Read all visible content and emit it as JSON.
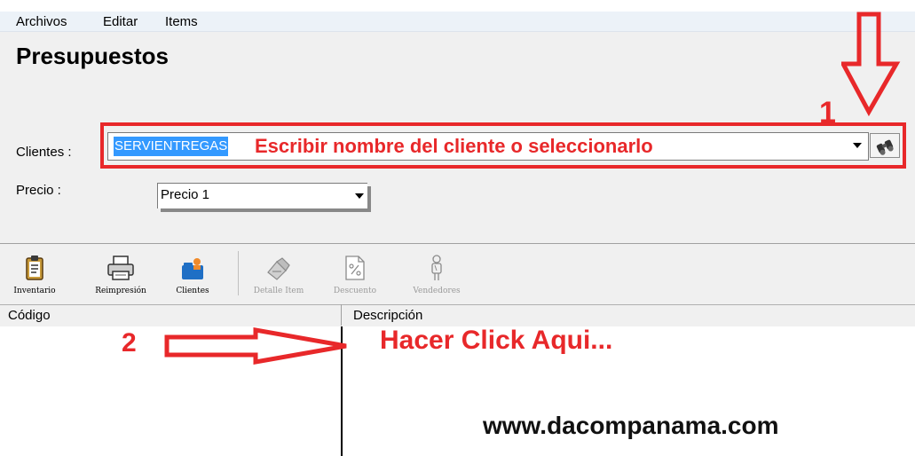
{
  "menu": {
    "items": [
      "Archivos",
      "Editar",
      "Items"
    ]
  },
  "page": {
    "title": "Presupuestos"
  },
  "form": {
    "clients_label": "Clientes :",
    "client_value": "SERVIENTREGAS",
    "price_label": "Precio :",
    "price_value": "Precio 1"
  },
  "toolbar": {
    "items": [
      {
        "label": "Inventario",
        "icon": "clipboard-icon",
        "enabled": true
      },
      {
        "label": "Reimpresión",
        "icon": "printer-icon",
        "enabled": true
      },
      {
        "label": "Clientes",
        "icon": "clients-icon",
        "enabled": true
      },
      {
        "label": "Detalle Item",
        "icon": "edit-item-icon",
        "enabled": false
      },
      {
        "label": "Descuento",
        "icon": "discount-icon",
        "enabled": false
      },
      {
        "label": "Vendedores",
        "icon": "sellers-icon",
        "enabled": false
      }
    ]
  },
  "grid": {
    "columns": [
      "Código",
      "Descripción"
    ]
  },
  "annotations": {
    "step1_number": "1",
    "step1_text": "Escribir nombre del cliente o seleccionarlo",
    "step2_number": "2",
    "step2_text": "Hacer Click Aqui...",
    "website": "www.dacompanama.com"
  },
  "colors": {
    "annotation": "#e8282a",
    "selection": "#3399ff",
    "menubar": "#ecf2f8",
    "form_bg": "#f0f0f0"
  }
}
